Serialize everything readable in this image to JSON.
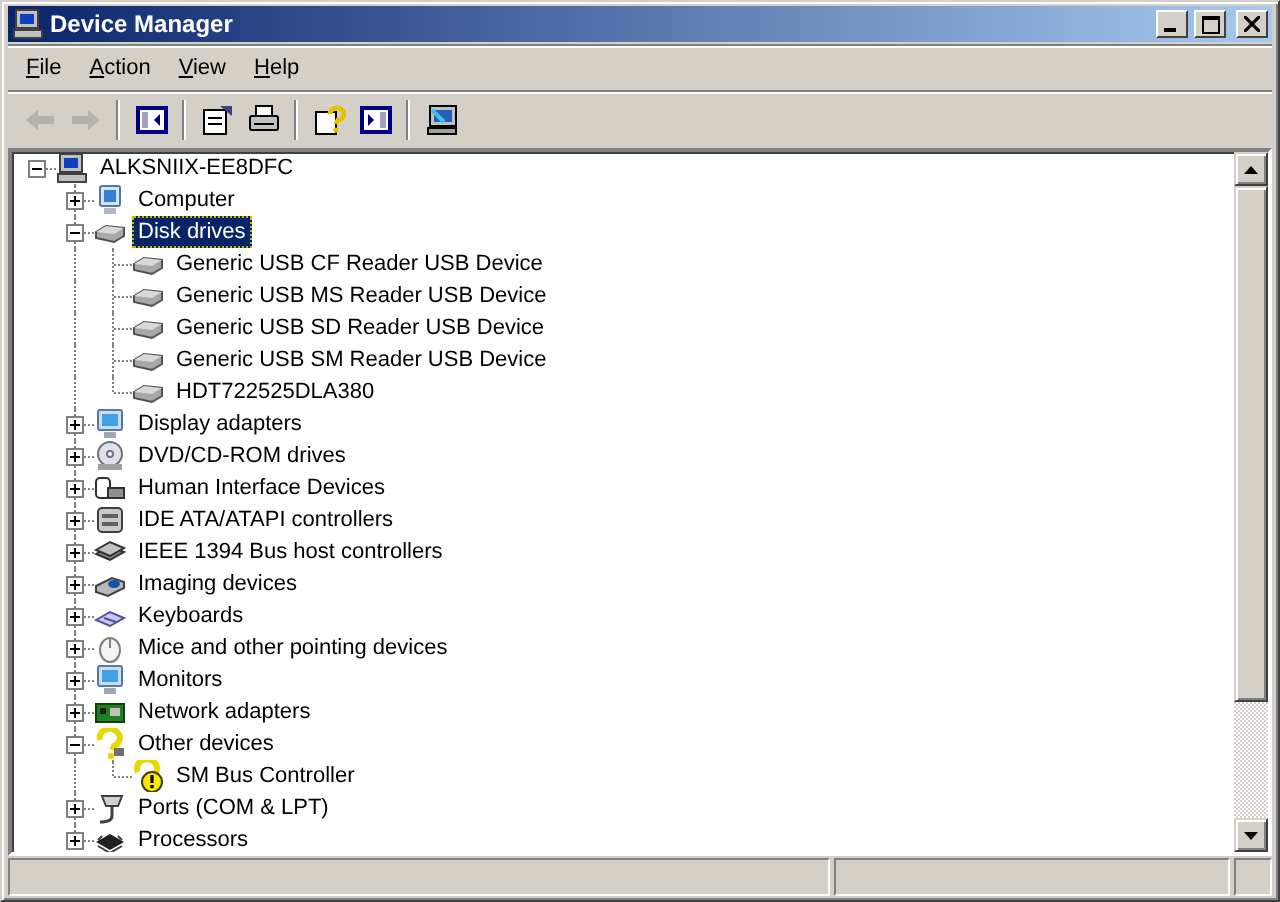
{
  "window": {
    "title": "Device Manager"
  },
  "menu": [
    {
      "label": "File"
    },
    {
      "label": "Action"
    },
    {
      "label": "View"
    },
    {
      "label": "Help"
    }
  ],
  "toolbar": [
    [
      {
        "kind": "back",
        "disabled": true
      },
      {
        "kind": "forward",
        "disabled": true
      }
    ],
    [
      {
        "kind": "tree-pane",
        "disabled": false
      }
    ],
    [
      {
        "kind": "properties",
        "disabled": false
      },
      {
        "kind": "print",
        "disabled": false
      }
    ],
    [
      {
        "kind": "help",
        "disabled": false
      },
      {
        "kind": "action-pane",
        "disabled": false
      }
    ],
    [
      {
        "kind": "scan",
        "disabled": false
      }
    ]
  ],
  "device_tree": {
    "label": "ALKSNIIX-EE8DFC",
    "kind": "computer",
    "expanded": true,
    "selected": false,
    "children": [
      {
        "label": "Computer",
        "kind": "pc",
        "expanded": false,
        "selected": false
      },
      {
        "label": "Disk drives",
        "kind": "disk",
        "expanded": true,
        "selected": true,
        "children": [
          {
            "label": "Generic USB CF Reader USB Device",
            "kind": "disk",
            "selected": false
          },
          {
            "label": "Generic USB MS Reader USB Device",
            "kind": "disk",
            "selected": false
          },
          {
            "label": "Generic USB SD Reader USB Device",
            "kind": "disk",
            "selected": false
          },
          {
            "label": "Generic USB SM Reader USB Device",
            "kind": "disk",
            "selected": false
          },
          {
            "label": "HDT722525DLA380",
            "kind": "disk",
            "selected": false
          }
        ]
      },
      {
        "label": "Display adapters",
        "kind": "display",
        "expanded": false,
        "selected": false
      },
      {
        "label": "DVD/CD-ROM drives",
        "kind": "cdrom",
        "expanded": false,
        "selected": false
      },
      {
        "label": "Human Interface Devices",
        "kind": "hid",
        "expanded": false,
        "selected": false
      },
      {
        "label": "IDE ATA/ATAPI controllers",
        "kind": "ide",
        "expanded": false,
        "selected": false
      },
      {
        "label": "IEEE 1394 Bus host controllers",
        "kind": "bus",
        "expanded": false,
        "selected": false
      },
      {
        "label": "Imaging devices",
        "kind": "camera",
        "expanded": false,
        "selected": false
      },
      {
        "label": "Keyboards",
        "kind": "keyboard",
        "expanded": false,
        "selected": false
      },
      {
        "label": "Mice and other pointing devices",
        "kind": "mouse",
        "expanded": false,
        "selected": false
      },
      {
        "label": "Monitors",
        "kind": "display",
        "expanded": false,
        "selected": false
      },
      {
        "label": "Network adapters",
        "kind": "network",
        "expanded": false,
        "selected": false
      },
      {
        "label": "Other devices",
        "kind": "unknown",
        "expanded": true,
        "selected": false,
        "children": [
          {
            "label": "SM Bus Controller",
            "kind": "warning",
            "selected": false
          }
        ]
      },
      {
        "label": "Ports (COM & LPT)",
        "kind": "port",
        "expanded": false,
        "selected": false
      },
      {
        "label": "Processors",
        "kind": "cpu",
        "expanded": false,
        "selected": false
      }
    ]
  }
}
